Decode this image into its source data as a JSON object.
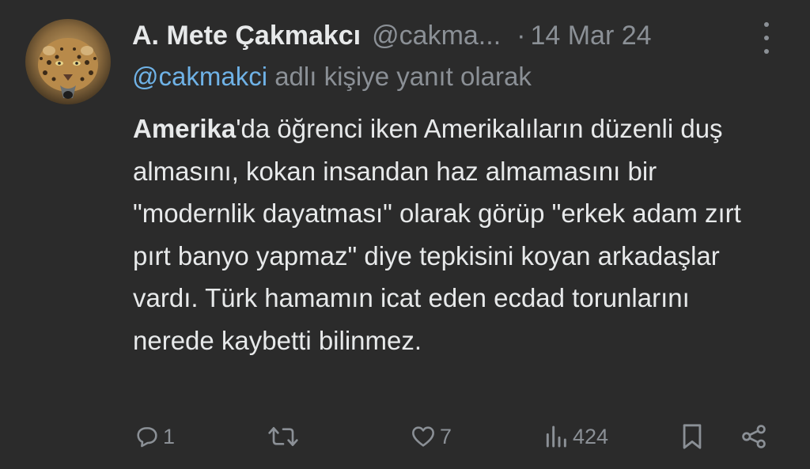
{
  "author": {
    "display_name": "A. Mete Çakmakcı",
    "handle": "@cakma...",
    "separator": "·",
    "timestamp": "14 Mar 24",
    "avatar": "leopard-avatar"
  },
  "reply_context": {
    "mention": "@cakmakci",
    "text": " adlı kişiye yanıt olarak"
  },
  "tweet": {
    "bold_word": "Amerika",
    "text": "'da öğrenci iken Amerikalıların düzenli duş almasını, kokan insandan haz almamasını bir \"modernlik dayatması\" olarak görüp \"erkek adam zırt pırt banyo yapmaz\" diye tepkisini koyan arkadaşlar vardı. Türk hamamın icat eden ecdad torunlarını nerede kaybetti bilinmez."
  },
  "actions": {
    "replies": "1",
    "retweets": "",
    "likes": "7",
    "views": "424"
  },
  "icons": [
    "more-icon",
    "reply-icon",
    "retweet-icon",
    "like-icon",
    "views-icon",
    "bookmark-icon",
    "share-icon"
  ],
  "colors": {
    "background": "#2b2b2b",
    "text": "#e7e9ea",
    "secondary": "#8b9096",
    "link": "#6fb2e6"
  }
}
